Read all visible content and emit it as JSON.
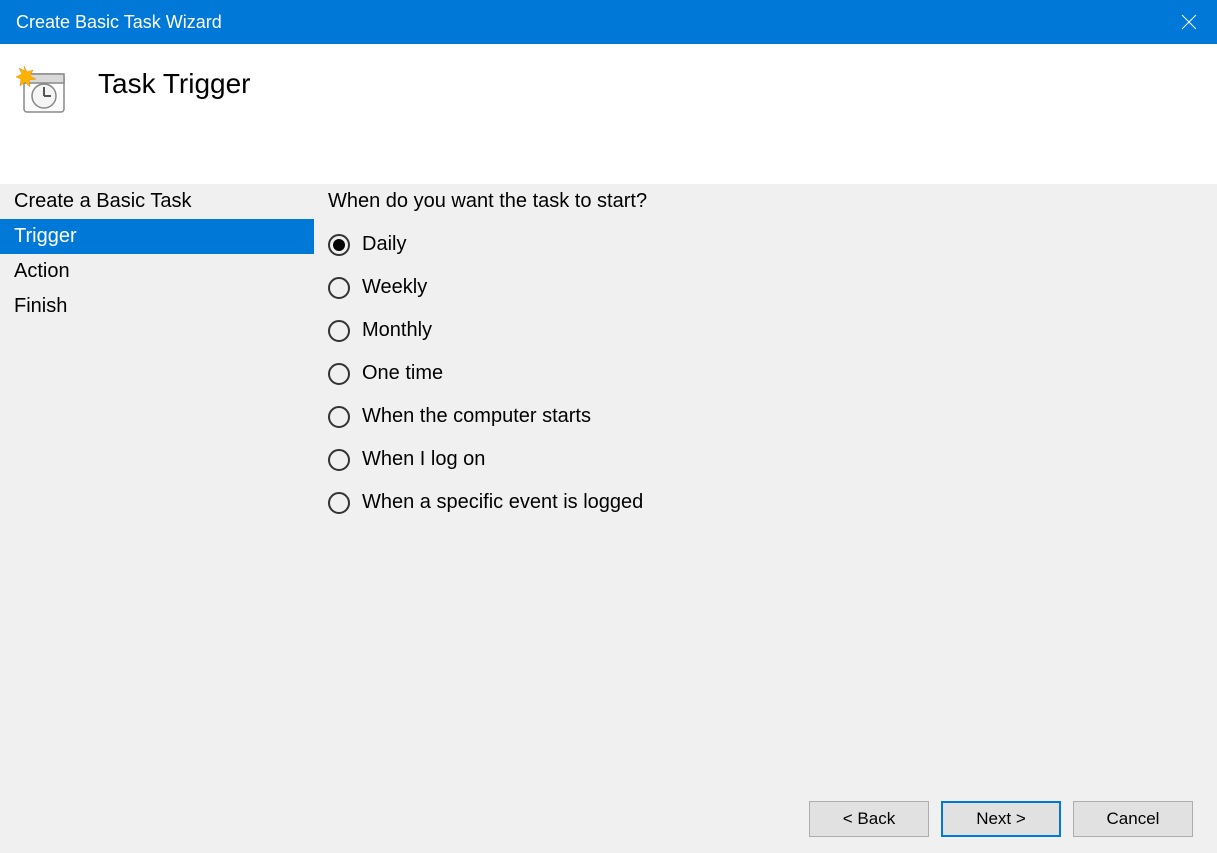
{
  "titlebar": {
    "title": "Create Basic Task Wizard"
  },
  "header": {
    "title": "Task Trigger"
  },
  "sidebar": {
    "items": [
      {
        "label": "Create a Basic Task",
        "active": false
      },
      {
        "label": "Trigger",
        "active": true
      },
      {
        "label": "Action",
        "active": false
      },
      {
        "label": "Finish",
        "active": false
      }
    ]
  },
  "main": {
    "question": "When do you want the task to start?",
    "options": [
      {
        "label": "Daily",
        "selected": true
      },
      {
        "label": "Weekly",
        "selected": false
      },
      {
        "label": "Monthly",
        "selected": false
      },
      {
        "label": "One time",
        "selected": false
      },
      {
        "label": "When the computer starts",
        "selected": false
      },
      {
        "label": "When I log on",
        "selected": false
      },
      {
        "label": "When a specific event is logged",
        "selected": false
      }
    ]
  },
  "footer": {
    "back": "< Back",
    "next": "Next >",
    "cancel": "Cancel"
  }
}
